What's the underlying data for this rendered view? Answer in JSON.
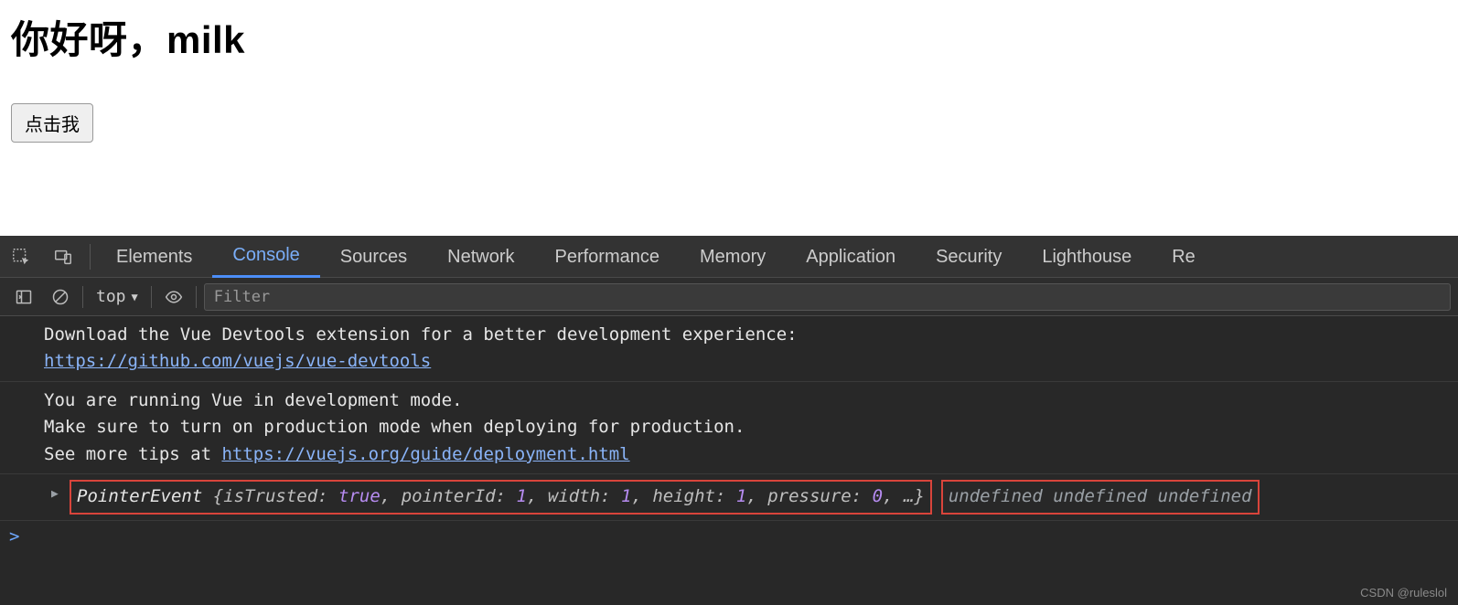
{
  "page": {
    "heading": "你好呀，milk",
    "button_label": "点击我"
  },
  "devtools": {
    "tabs": [
      "Elements",
      "Console",
      "Sources",
      "Network",
      "Performance",
      "Memory",
      "Application",
      "Security",
      "Lighthouse",
      "Re"
    ],
    "active_tab_index": 1,
    "toolbar": {
      "context_label": "top",
      "filter_placeholder": "Filter"
    },
    "messages": {
      "m1_line1": "Download the Vue Devtools extension for a better development experience:",
      "m1_link": "https://github.com/vuejs/vue-devtools",
      "m2_line1": "You are running Vue in development mode.",
      "m2_line2": "Make sure to turn on production mode when deploying for production.",
      "m2_line3_prefix": "See more tips at ",
      "m2_link": "https://vuejs.org/guide/deployment.html"
    },
    "log": {
      "event_name": "PointerEvent",
      "pairs": [
        {
          "k": "isTrusted",
          "v": "true",
          "type": "bool"
        },
        {
          "k": "pointerId",
          "v": "1",
          "type": "num"
        },
        {
          "k": "width",
          "v": "1",
          "type": "num"
        },
        {
          "k": "height",
          "v": "1",
          "type": "num"
        },
        {
          "k": "pressure",
          "v": "0",
          "type": "num"
        }
      ],
      "ellipsis": "…",
      "trailing": "undefined undefined undefined"
    },
    "prompt": ">"
  },
  "watermark": "CSDN @ruleslol"
}
